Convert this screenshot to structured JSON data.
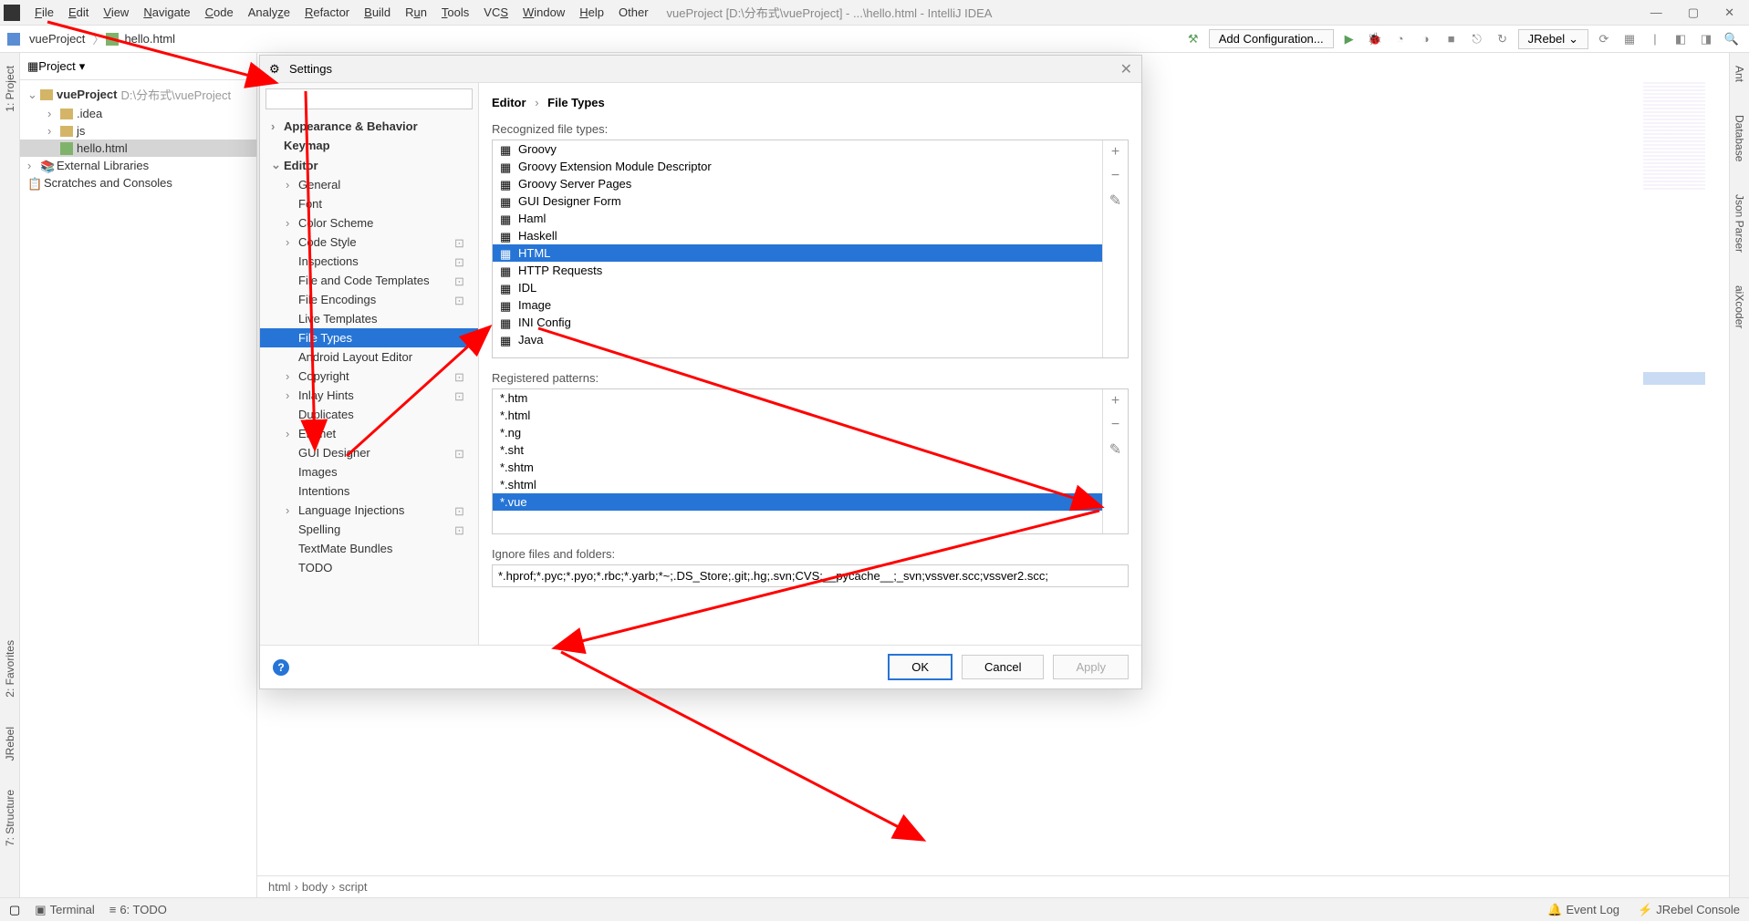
{
  "menubar": [
    "File",
    "Edit",
    "View",
    "Navigate",
    "Code",
    "Analyze",
    "Refactor",
    "Build",
    "Run",
    "Tools",
    "VCS",
    "Window",
    "Help",
    "Other"
  ],
  "title": "vueProject [D:\\分布式\\vueProject] - ...\\hello.html - IntelliJ IDEA",
  "breadcrumb": {
    "root": "vueProject",
    "file": "hello.html"
  },
  "toolbar": {
    "config": "Add Configuration...",
    "jrebel": "JRebel"
  },
  "left_tabs": [
    "1: Project"
  ],
  "right_tabs": [
    "Ant",
    "Database",
    "Json Parser",
    "aiXcoder"
  ],
  "left_bottom_tabs": [
    "2: Favorites",
    "JRebel",
    "7: Structure"
  ],
  "project": {
    "title": "Project",
    "root": "vueProject",
    "root_path": "D:\\分布式\\vueProject",
    "items": [
      {
        "name": ".idea",
        "type": "folder"
      },
      {
        "name": "js",
        "type": "folder"
      },
      {
        "name": "hello.html",
        "type": "file",
        "selected": true
      }
    ],
    "ext_libs": "External Libraries",
    "scratches": "Scratches and Consoles"
  },
  "settings": {
    "title": "Settings",
    "search_placeholder": "",
    "tree": [
      {
        "label": "Appearance & Behavior",
        "bold": true,
        "chev": "›",
        "l": 0
      },
      {
        "label": "Keymap",
        "bold": true,
        "l": 0
      },
      {
        "label": "Editor",
        "bold": true,
        "chev": "⌄",
        "l": 0
      },
      {
        "label": "General",
        "chev": "›",
        "l": 1
      },
      {
        "label": "Font",
        "l": 1
      },
      {
        "label": "Color Scheme",
        "chev": "›",
        "l": 1
      },
      {
        "label": "Code Style",
        "chev": "›",
        "l": 1,
        "badge": true
      },
      {
        "label": "Inspections",
        "l": 1,
        "badge": true
      },
      {
        "label": "File and Code Templates",
        "l": 1,
        "badge": true
      },
      {
        "label": "File Encodings",
        "l": 1,
        "badge": true
      },
      {
        "label": "Live Templates",
        "l": 1
      },
      {
        "label": "File Types",
        "l": 1,
        "selected": true
      },
      {
        "label": "Android Layout Editor",
        "l": 1
      },
      {
        "label": "Copyright",
        "chev": "›",
        "l": 1,
        "badge": true
      },
      {
        "label": "Inlay Hints",
        "chev": "›",
        "l": 1,
        "badge": true
      },
      {
        "label": "Duplicates",
        "l": 1
      },
      {
        "label": "Emmet",
        "chev": "›",
        "l": 1
      },
      {
        "label": "GUI Designer",
        "l": 1,
        "badge": true
      },
      {
        "label": "Images",
        "l": 1
      },
      {
        "label": "Intentions",
        "l": 1
      },
      {
        "label": "Language Injections",
        "chev": "›",
        "l": 1,
        "badge": true
      },
      {
        "label": "Spelling",
        "l": 1,
        "badge": true
      },
      {
        "label": "TextMate Bundles",
        "l": 1
      },
      {
        "label": "TODO",
        "l": 1
      }
    ],
    "content": {
      "crumb1": "Editor",
      "crumb2": "File Types",
      "recognized_label": "Recognized file types:",
      "filetypes": [
        "Groovy",
        "Groovy Extension Module Descriptor",
        "Groovy Server Pages",
        "GUI Designer Form",
        "Haml",
        "Haskell",
        "HTML",
        "HTTP Requests",
        "IDL",
        "Image",
        "INI Config",
        "Java"
      ],
      "filetype_selected": "HTML",
      "patterns_label": "Registered patterns:",
      "patterns": [
        "*.htm",
        "*.html",
        "*.ng",
        "*.sht",
        "*.shtm",
        "*.shtml",
        "*.vue"
      ],
      "pattern_selected": "*.vue",
      "ignore_label": "Ignore files and folders:",
      "ignore_value": "*.hprof;*.pyc;*.pyo;*.rbc;*.yarb;*~;.DS_Store;.git;.hg;.svn;CVS;__pycache__;_svn;vssver.scc;vssver2.scc;"
    },
    "buttons": {
      "ok": "OK",
      "cancel": "Cancel",
      "apply": "Apply"
    }
  },
  "bottom_crumb": [
    "html",
    "body",
    "script"
  ],
  "statusbar": {
    "terminal": "Terminal",
    "todo": "6: TODO",
    "eventlog": "Event Log",
    "jrebel": "JRebel Console"
  }
}
